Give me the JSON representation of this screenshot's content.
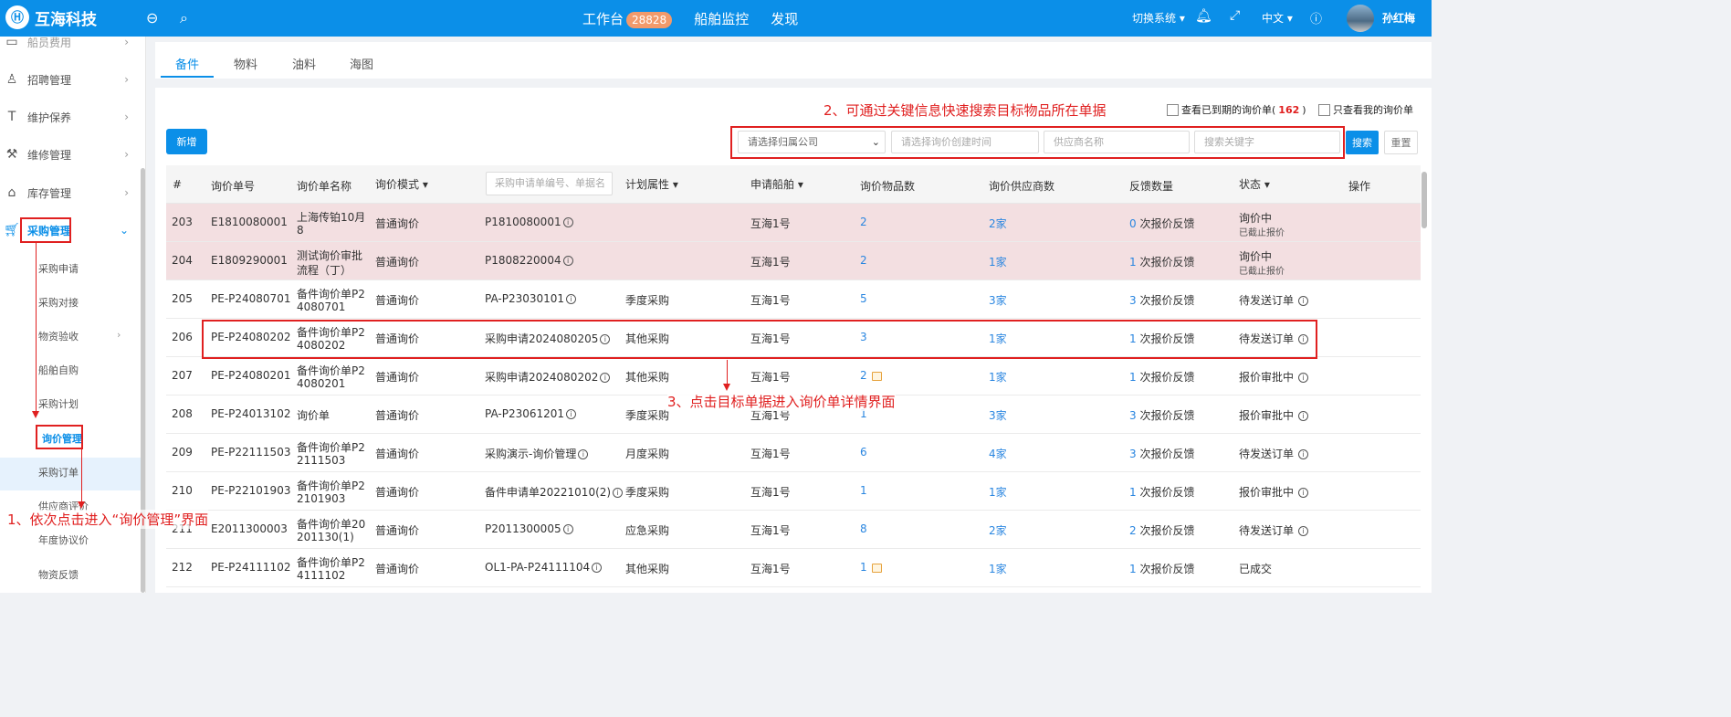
{
  "app": {
    "name": "互海科技"
  },
  "topnav": {
    "workbench": "工作台",
    "workbench_badge": "28828",
    "ship_monitor": "船舶监控",
    "discover": "发现"
  },
  "topright": {
    "switch_system": "切换系统",
    "language": "中文",
    "user": "孙红梅"
  },
  "sidebar": {
    "items": [
      {
        "label": "船员费用",
        "icon": "fee-icon"
      },
      {
        "label": "招聘管理",
        "icon": "user-add-icon"
      },
      {
        "label": "维护保养",
        "icon": "maintenance-icon"
      },
      {
        "label": "维修管理",
        "icon": "wrench-icon"
      },
      {
        "label": "库存管理",
        "icon": "home-icon"
      },
      {
        "label": "采购管理",
        "icon": "cart-icon"
      }
    ],
    "subitems": [
      "采购申请",
      "采购对接",
      "物资验收",
      "船舶自购",
      "采购计划",
      "询价管理",
      "采购订单",
      "供应商评价",
      "年度协议价",
      "物资反馈"
    ]
  },
  "tabs": [
    "备件",
    "物料",
    "油料",
    "海图"
  ],
  "toolbar": {
    "new_button": "新增",
    "expired_checkbox_label": "查看已到期的询价单(",
    "expired_count": "162",
    "expired_close": ")",
    "mine_checkbox_label": "只查看我的询价单",
    "company_placeholder": "请选择归属公司",
    "time_placeholder": "请选择询价创建时间",
    "supplier_placeholder": "供应商名称",
    "keyword_placeholder": "搜索关键字",
    "search_button": "搜索",
    "reset_button": "重置"
  },
  "table": {
    "headers": [
      "#",
      "询价单号",
      "询价单名称",
      "询价模式",
      "计划属性",
      "申请船舶",
      "询价物品数",
      "询价供应商数",
      "反馈数量",
      "状态",
      "操作"
    ],
    "filter_placeholder": "采购申请单编号、单据名",
    "rows": [
      {
        "no": "203",
        "code": "E1810080001",
        "name1": "上海传铂10月",
        "name2": "8",
        "mode": "普通询价",
        "req": "P1810080001",
        "plan": "",
        "ship": "互海1号",
        "items": "2",
        "suppliers": "2家",
        "feedback_n": "0",
        "feedback": "次报价反馈",
        "status": "询价中",
        "status_sub": "已截止报价",
        "status_info": false,
        "pink": true,
        "itemicon": false
      },
      {
        "no": "204",
        "code": "E1809290001",
        "name1": "测试询价审批",
        "name2": "流程（丁）",
        "mode": "普通询价",
        "req": "P1808220004",
        "plan": "",
        "ship": "互海1号",
        "items": "2",
        "suppliers": "1家",
        "feedback_n": "1",
        "feedback": "次报价反馈",
        "status": "询价中",
        "status_sub": "已截止报价",
        "status_info": false,
        "pink": true,
        "itemicon": false
      },
      {
        "no": "205",
        "code": "PE-P24080701",
        "name1": "备件询价单P2",
        "name2": "4080701",
        "mode": "普通询价",
        "req": "PA-P23030101",
        "plan": "季度采购",
        "ship": "互海1号",
        "items": "5",
        "suppliers": "3家",
        "feedback_n": "3",
        "feedback": "次报价反馈",
        "status": "待发送订单",
        "status_sub": "",
        "status_info": true,
        "pink": false,
        "itemicon": false
      },
      {
        "no": "206",
        "code": "PE-P24080202",
        "name1": "备件询价单P2",
        "name2": "4080202",
        "mode": "普通询价",
        "req": "采购申请2024080205",
        "plan": "其他采购",
        "ship": "互海1号",
        "items": "3",
        "suppliers": "1家",
        "feedback_n": "1",
        "feedback": "次报价反馈",
        "status": "待发送订单",
        "status_sub": "",
        "status_info": true,
        "pink": false,
        "itemicon": false
      },
      {
        "no": "207",
        "code": "PE-P24080201",
        "name1": "备件询价单P2",
        "name2": "4080201",
        "mode": "普通询价",
        "req": "采购申请2024080202",
        "plan": "其他采购",
        "ship": "互海1号",
        "items": "2",
        "suppliers": "1家",
        "feedback_n": "1",
        "feedback": "次报价反馈",
        "status": "报价审批中",
        "status_sub": "",
        "status_info": true,
        "pink": false,
        "itemicon": true
      },
      {
        "no": "208",
        "code": "PE-P24013102",
        "name1": "询价单",
        "name2": "",
        "mode": "普通询价",
        "req": "PA-P23061201",
        "plan": "季度采购",
        "ship": "互海1号",
        "items": "1",
        "suppliers": "3家",
        "feedback_n": "3",
        "feedback": "次报价反馈",
        "status": "报价审批中",
        "status_sub": "",
        "status_info": true,
        "pink": false,
        "itemicon": false
      },
      {
        "no": "209",
        "code": "PE-P22111503",
        "name1": "备件询价单P2",
        "name2": "2111503",
        "mode": "普通询价",
        "req": "采购演示-询价管理",
        "plan": "月度采购",
        "ship": "互海1号",
        "items": "6",
        "suppliers": "4家",
        "feedback_n": "3",
        "feedback": "次报价反馈",
        "status": "待发送订单",
        "status_sub": "",
        "status_info": true,
        "pink": false,
        "itemicon": false
      },
      {
        "no": "210",
        "code": "PE-P22101903",
        "name1": "备件询价单P2",
        "name2": "2101903",
        "mode": "普通询价",
        "req": "备件申请单20221010(2)",
        "plan": "季度采购",
        "ship": "互海1号",
        "items": "1",
        "suppliers": "1家",
        "feedback_n": "1",
        "feedback": "次报价反馈",
        "status": "报价审批中",
        "status_sub": "",
        "status_info": true,
        "pink": false,
        "itemicon": false
      },
      {
        "no": "211",
        "code": "E2011300003",
        "name1": "备件询价单20",
        "name2": "201130(1)",
        "mode": "普通询价",
        "req": "P2011300005",
        "plan": "应急采购",
        "ship": "互海1号",
        "items": "8",
        "suppliers": "2家",
        "feedback_n": "2",
        "feedback": "次报价反馈",
        "status": "待发送订单",
        "status_sub": "",
        "status_info": true,
        "pink": false,
        "itemicon": false
      },
      {
        "no": "212",
        "code": "PE-P24111102",
        "name1": "备件询价单P2",
        "name2": "4111102",
        "mode": "普通询价",
        "req": "OL1-PA-P24111104",
        "plan": "其他采购",
        "ship": "互海1号",
        "items": "1",
        "suppliers": "1家",
        "feedback_n": "1",
        "feedback": "次报价反馈",
        "status": "已成交",
        "status_sub": "",
        "status_info": false,
        "pink": false,
        "itemicon": true
      }
    ]
  },
  "annotations": {
    "step1": "1、依次点击进入“询价管理”界面",
    "step2": "2、可通过关键信息快速搜索目标物品所在单据",
    "step3": "3、点击目标单据进入询价单详情界面"
  },
  "colors": {
    "brand": "#0b8fe8",
    "annotation": "#e02020",
    "expired_row": "#f3dfe1",
    "link": "#2a86e0"
  }
}
